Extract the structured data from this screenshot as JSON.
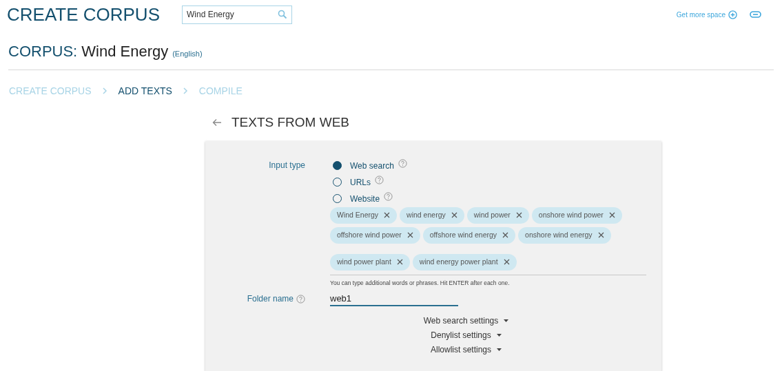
{
  "header": {
    "title": "CREATE CORPUS",
    "search": {
      "value": "Wind Energy"
    },
    "more_space_link": "Get more space"
  },
  "corpus": {
    "label": "CORPUS:",
    "name": "Wind Energy",
    "language": "(English)"
  },
  "steps": [
    {
      "label": "CREATE CORPUS",
      "selected": false
    },
    {
      "label": "ADD TEXTS",
      "selected": true
    },
    {
      "label": "COMPILE",
      "selected": false
    }
  ],
  "section_title": "TEXTS FROM WEB",
  "form": {
    "input_type_label": "Input type",
    "input_types": [
      {
        "label": "Web search",
        "selected": true
      },
      {
        "label": "URLs",
        "selected": false
      },
      {
        "label": "Website",
        "selected": false
      }
    ],
    "tag_rows": [
      [
        "Wind Energy",
        "wind energy",
        "wind power",
        "onshore wind power"
      ],
      [
        "offshore wind power",
        "offshore wind energy",
        "onshore wind energy"
      ],
      [
        "wind power plant",
        "wind energy power plant"
      ]
    ],
    "tags_hint": "You can type additional words or phrases. Hit ENTER after each one.",
    "folder_label": "Folder name",
    "folder_value": "web1",
    "settings": [
      "Web search settings",
      "Denylist settings",
      "Allowlist settings"
    ]
  }
}
